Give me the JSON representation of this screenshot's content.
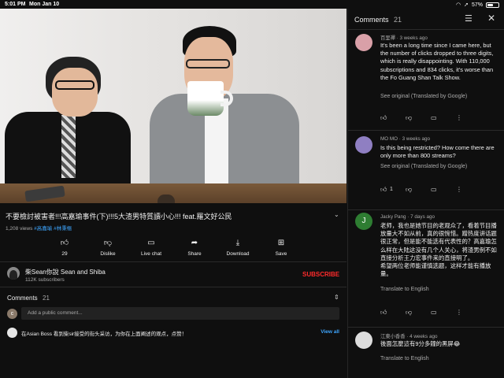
{
  "status_bar": {
    "time": "5:01 PM",
    "date": "Mon Jan 10",
    "battery": "57%",
    "battery_level": 0.57
  },
  "video": {
    "title": "不要檢討被害者!!!高嘉瑜事件(下)!!!5大渣男特質讀小心!!! feat.羅文好公民",
    "views": "1,208 views",
    "tags": [
      "#高嘉瑜",
      "#林秉樞"
    ],
    "progress": 0.01
  },
  "actions": [
    {
      "icon": "thumbs-up-icon",
      "label": "29"
    },
    {
      "icon": "thumbs-down-icon",
      "label": "Dislike"
    },
    {
      "icon": "live-chat-icon",
      "label": "Live chat"
    },
    {
      "icon": "share-icon",
      "label": "Share"
    },
    {
      "icon": "download-icon",
      "label": "Download"
    },
    {
      "icon": "save-icon",
      "label": "Save"
    }
  ],
  "channel": {
    "name": "柴Sean你說 Sean and Shiba",
    "subscribers": "112K subscribers",
    "subscribe_label": "SUBSCRIBE"
  },
  "comments_box": {
    "label": "Comments",
    "count": "21",
    "avatar_letter": "c",
    "placeholder": "Add a public comment...",
    "first_comment": "在Asian Boss 看到柴sir接受的街头采访，为你在上面阐述的观点，点赞！",
    "view_all": "View all"
  },
  "panel": {
    "title": "Comments",
    "count": "21",
    "comments": [
      {
        "author": "百里禪",
        "time": "3 weeks ago",
        "text": "It's been a long time since I came here, but the number of clicks dropped to three digits, which is really disappointing. With 110,000 subscriptions and 834 clicks, it's worse than the Fo Guang Shan Talk Show.",
        "link": "See original (Translated by Google)",
        "likes": ""
      },
      {
        "author": "MO MO",
        "time": "3 weeks ago",
        "text": "Is this being restricted? How come there are only more than 800 streams?",
        "link": "See original (Translated by Google)",
        "likes": "1"
      },
      {
        "author": "Jacky Pang",
        "avatar_letter": "J",
        "time": "7 days ago",
        "text": "老师，我也是她节目的老观众了，看着节目播放量大不如从前，真的很惋惜。蹭热度讲话题很正常，但是能不能选有代表性的？高嘉瑜怎么样在大陆这没有几个人关心，将渣男例不如直接分析王力宏事件来的直接明了。\n希望两位老师能谨慎选题，这样才能有播放量。",
        "link": "Translate to English",
        "likes": ""
      },
      {
        "author": "江東小香香",
        "time": "4 weeks ago",
        "text": "後面怎麼這有9分多鐘的黑屏😂",
        "link": "Translate to English",
        "likes": ""
      }
    ]
  },
  "colors": {
    "accent_red": "#ff2b2b",
    "link_blue": "#3ea6ff",
    "background": "#0f0f0f"
  }
}
